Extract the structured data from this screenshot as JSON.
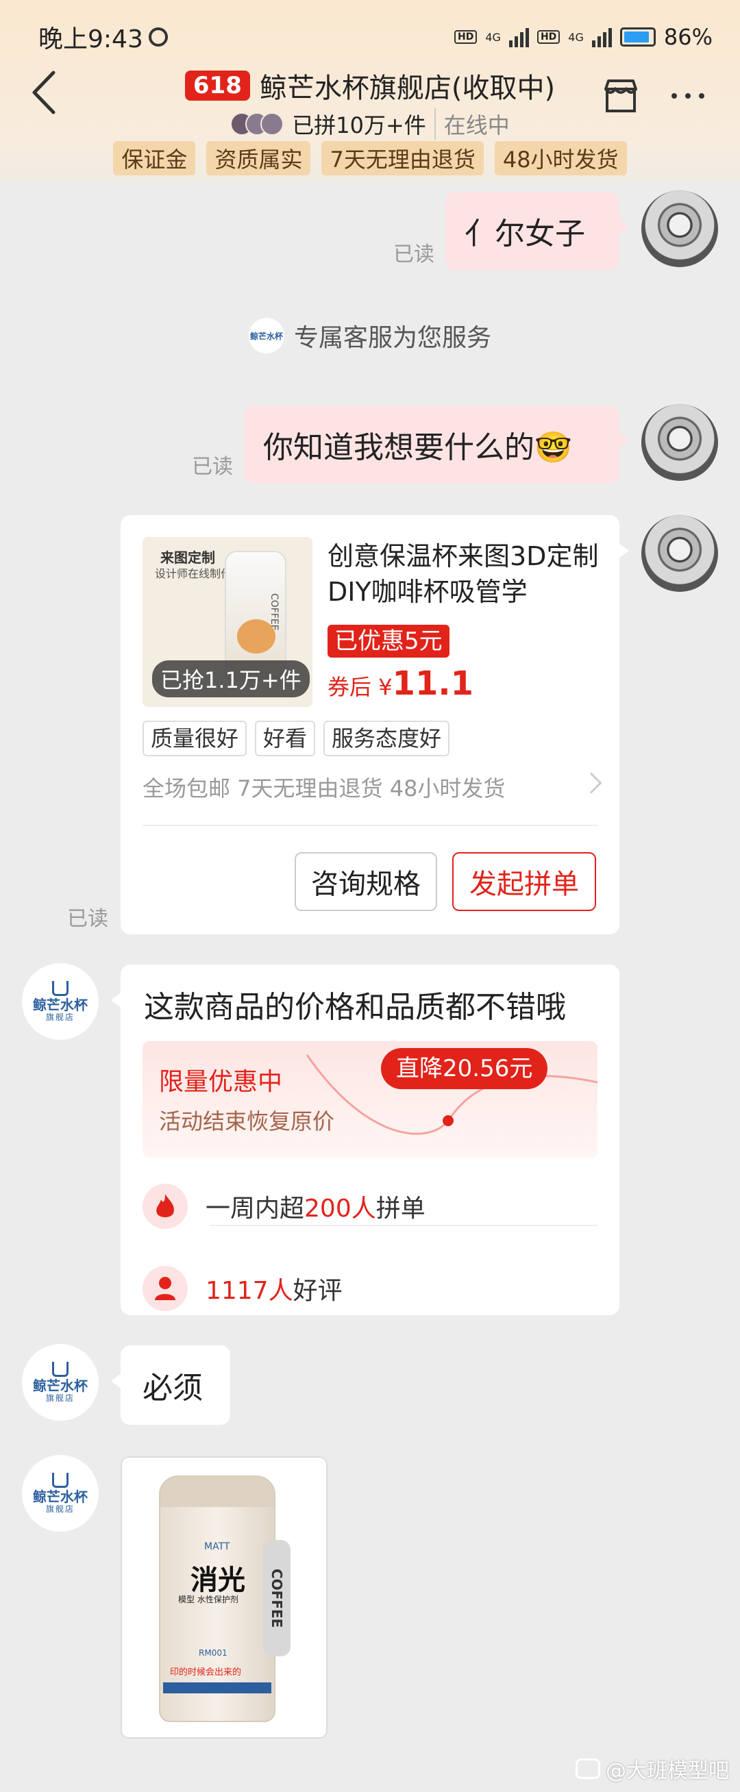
{
  "status_bar": {
    "time": "晚上9:43",
    "network_1": "4G",
    "network_2": "4G",
    "hd": "HD",
    "battery": "86%"
  },
  "header": {
    "badge": "618",
    "title": "鲸芒水杯旗舰店(收取中)",
    "group_count": "已拼10万+件",
    "online_status": "在线中",
    "tags": [
      "保证金",
      "资质属实",
      "7天无理由退货",
      "48小时发货"
    ]
  },
  "messages": {
    "msg1": {
      "text": "亻尔女子",
      "read": "已读"
    },
    "system": {
      "text": "专属客服为您服务",
      "logo_text": "鲸芒水杯"
    },
    "msg2": {
      "text": "你知道我想要什么的🤓",
      "read": "已读"
    },
    "product": {
      "image_title": "来图定制",
      "image_subtitle": "设计师在线制作",
      "image_cup_text": "COFFEE",
      "sold": "已抢1.1万+件",
      "title": "创意保温杯来图3D定制DIY咖啡杯吸管学",
      "coupon": "已优惠5元",
      "price_prefix": "券后",
      "currency": "¥",
      "price": "11.1",
      "tags": [
        "质量很好",
        "好看",
        "服务态度好"
      ],
      "services": "全场包邮 7天无理由退货 48小时发货",
      "btn_consult": "咨询规格",
      "btn_group": "发起拼单",
      "read": "已读"
    },
    "promo": {
      "title": "这款商品的价格和品质都不错哦",
      "limited": "限量优惠中",
      "restore": "活动结束恢复原价",
      "drop": "直降20.56元",
      "stat1_pre": "一周内超",
      "stat1_num": "200人",
      "stat1_post": "拼单",
      "stat2_num": "1117人",
      "stat2_post": "好评"
    },
    "msg_must": {
      "text": "必须"
    },
    "image_msg": {
      "brand": "MATT",
      "big": "消光",
      "sub": "模型 水性保护剂",
      "code": "RM001",
      "strip": "印的时候会出来的",
      "side": "COFFEE"
    }
  },
  "shop_avatar": {
    "name": "鲸芒水杯",
    "sub": "旗舰店"
  },
  "watermark": "@大班模型吧",
  "colors": {
    "accent": "#e2231a",
    "bubble_me": "#fde3e4",
    "bg": "#ececec",
    "brand_blue": "#2c5f9e"
  }
}
